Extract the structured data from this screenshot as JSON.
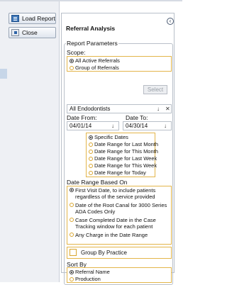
{
  "toolbar": {
    "load_report_label": "Load Report",
    "close_label": "Close"
  },
  "panel": {
    "title": "Referral Analysis",
    "group_title": "Report Parameters",
    "scope": {
      "label": "Scope:",
      "options": [
        "All Active Referrals",
        "Group of Referrals"
      ],
      "selected": "All Active Referrals",
      "select_button": "Select"
    },
    "provider_combo": {
      "value": "All Endodontists",
      "down_glyph": "↓",
      "clear_glyph": "✕"
    },
    "date_from": {
      "label": "Date From:",
      "value": "04/01/14",
      "glyph": "↓"
    },
    "date_to": {
      "label": "Date To:",
      "value": "04/30/14",
      "glyph": "↓"
    },
    "date_presets": {
      "options": [
        "Specific Dates",
        "Date Range for Last Month",
        "Date Range for This Month",
        "Date Range for Last Week",
        "Date Range for This Week",
        "Date Range for Today"
      ],
      "selected": "Specific Dates"
    },
    "date_basis": {
      "label": "Date Range Based On",
      "options": [
        "First Visit Date, to include patients regardless of the service provided",
        "Date of the Root Canal for 3000 Series ADA Codes Only",
        "Case Completed Date in the Case Tracking window for each patient",
        "Any Charge in the Date Range"
      ],
      "selected": "First Visit Date, to include patients regardless of the service provided"
    },
    "group_by_practice": {
      "label": "Group By Practice",
      "checked": false
    },
    "sort_by": {
      "label": "Sort By",
      "options": [
        "Referral Name",
        "Production"
      ],
      "selected": "Referral Name"
    }
  }
}
